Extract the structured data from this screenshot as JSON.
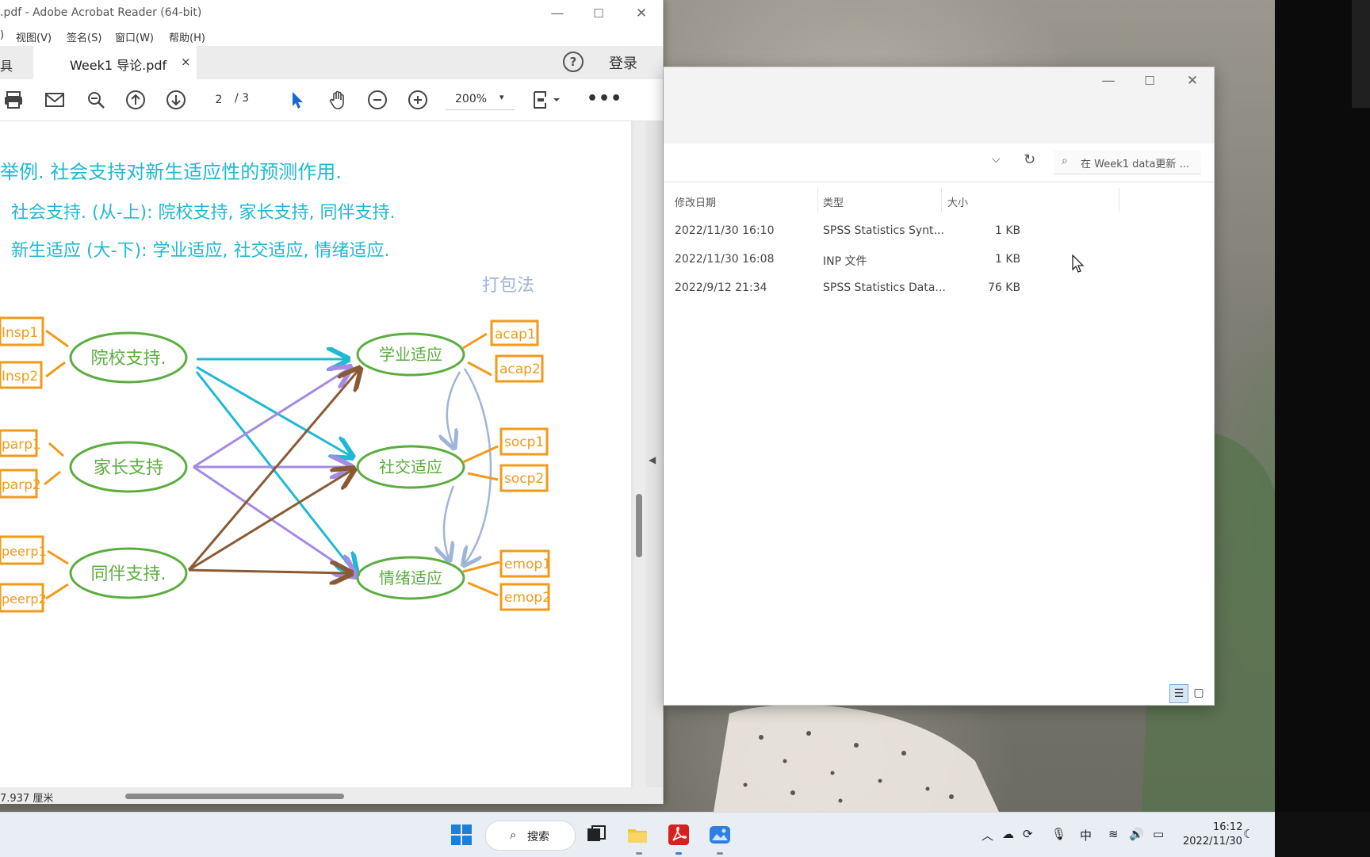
{
  "acrobat": {
    "title": ".pdf - Adobe Acrobat Reader (64-bit)",
    "menu": [
      ")",
      "视图(V)",
      "签名(S)",
      "窗口(W)",
      "帮助(H)"
    ],
    "tools_tab_fragment": "具",
    "tab_label": "Week1 导论.pdf",
    "tab_close": "×",
    "help": "?",
    "login": "登录",
    "page_current": "2",
    "page_total": "/ 3",
    "zoom": "200%",
    "more": "•••",
    "status_size": "7.937 厘米",
    "controls": {
      "minimize": "—",
      "maximize": "☐",
      "close": "✕"
    }
  },
  "page_content": {
    "heading": "举例.  社会支持对新生适应性的预测作用.",
    "line1": "社会支持. (从-上):  院校支持, 家长支持, 同伴支持.",
    "line2": "新生适应 (大-下):  学业适应, 社交适应, 情绪适应.",
    "side_note": "打包法",
    "left_latents": [
      "院校支持.",
      "家长支持",
      "同伴支持."
    ],
    "right_latents": [
      "学业适应",
      "社交适应",
      "情绪适应"
    ],
    "left_indicators": [
      "Insp1",
      "Insp2",
      "parp1",
      "parp2",
      "peerp1",
      "peerp2"
    ],
    "right_indicators": [
      "acap1",
      "acap2",
      "socp1",
      "socp2",
      "emop1",
      "emop2"
    ],
    "colors": {
      "cyan": "#1fb9d4",
      "purple": "#a58be6",
      "brown": "#8a5a34",
      "green": "#5cad3f",
      "orange": "#f29a1a",
      "blue_gray": "#9fb5d8"
    }
  },
  "explorer": {
    "controls": {
      "minimize": "—",
      "maximize": "☐",
      "close": "✕"
    },
    "search_placeholder": "在 Week1 data更新 ...",
    "columns": [
      "修改日期",
      "类型",
      "大小"
    ],
    "rows": [
      {
        "date": "2022/11/30 16:10",
        "type": "SPSS Statistics Synt...",
        "size": "1 KB"
      },
      {
        "date": "2022/11/30 16:08",
        "type": "INP 文件",
        "size": "1 KB"
      },
      {
        "date": "2022/9/12 21:34",
        "type": "SPSS Statistics Data...",
        "size": "76 KB"
      }
    ]
  },
  "taskbar": {
    "search_label": "搜索",
    "ime": "中",
    "time": "16:12",
    "date": "2022/11/30"
  }
}
